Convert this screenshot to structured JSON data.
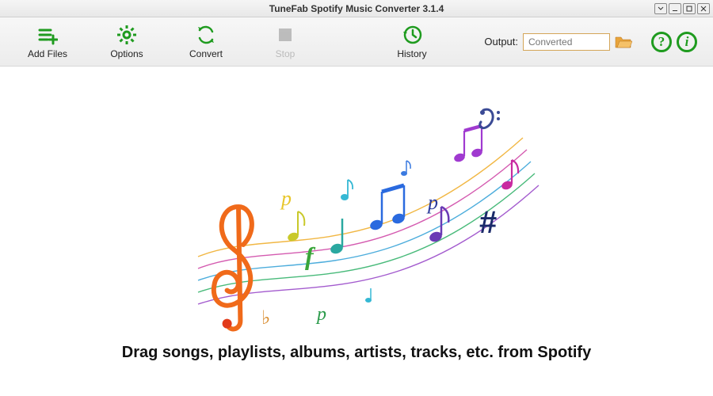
{
  "window": {
    "title": "TuneFab Spotify Music Converter 3.1.4"
  },
  "toolbar": {
    "add_files": "Add Files",
    "options": "Options",
    "convert": "Convert",
    "stop": "Stop",
    "history": "History"
  },
  "output": {
    "label": "Output:",
    "placeholder": "Converted"
  },
  "main": {
    "drag_hint": "Drag songs, playlists, albums, artists, tracks, etc. from Spotify"
  },
  "colors": {
    "accent": "#1f9b1f"
  }
}
